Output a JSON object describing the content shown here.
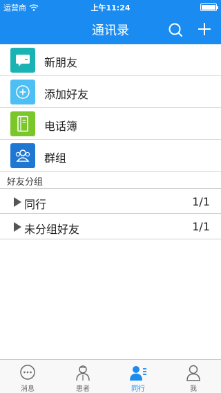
{
  "status": {
    "carrier": "运营商",
    "time": "上午11:24"
  },
  "nav": {
    "title": "通讯录",
    "search_icon": "search-icon",
    "add_icon": "plus-icon"
  },
  "functions": [
    {
      "label": "新朋友",
      "icon": "chat-bubble-icon",
      "color": "#1ab3b3"
    },
    {
      "label": "添加好友",
      "icon": "add-circle-icon",
      "color": "#4dbff5"
    },
    {
      "label": "电话簿",
      "icon": "notebook-icon",
      "color": "#7bc72a"
    },
    {
      "label": "群组",
      "icon": "group-icon",
      "color": "#1f77d4"
    }
  ],
  "groups": {
    "section_label": "好友分组",
    "items": [
      {
        "name": "同行",
        "count": "1/1"
      },
      {
        "name": "未分组好友",
        "count": "1/1"
      }
    ]
  },
  "tabbar": {
    "items": [
      {
        "label": "消息",
        "icon": "message-icon",
        "active": false
      },
      {
        "label": "患者",
        "icon": "patient-icon",
        "active": false
      },
      {
        "label": "同行",
        "icon": "colleagues-icon",
        "active": true
      },
      {
        "label": "我",
        "icon": "profile-icon",
        "active": false
      }
    ]
  },
  "colors": {
    "accent": "#1a8bf0",
    "tab_inactive": "#6b6b6b"
  }
}
